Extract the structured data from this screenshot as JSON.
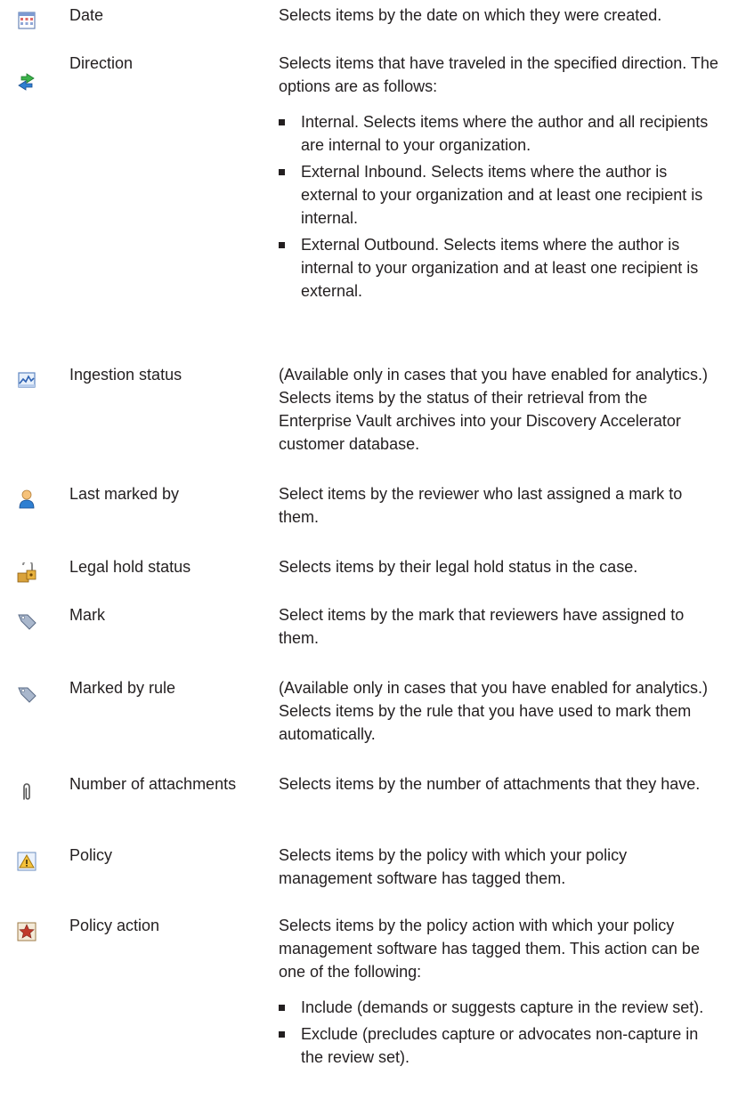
{
  "entries": [
    {
      "icon": "calendar-icon",
      "term": "Date",
      "description": "Selects items by the date on which they were created."
    },
    {
      "icon": "direction-arrows-icon",
      "term": "Direction",
      "description": "Selects items that have traveled in the specified direction. The options are as follows:",
      "bullets": [
        "Internal. Selects items where the author and all recipients are internal to your organization.",
        "External Inbound. Selects items where the author is external to your organization and at least one recipient is internal.",
        "External Outbound. Selects items where the author is internal to your organization and at least one recipient is external."
      ]
    },
    {
      "icon": "ingestion-chart-icon",
      "term": "Ingestion status",
      "description": "(Available only in cases that you have enabled for analytics.) Selects items by the status of their retrieval from the Enterprise Vault archives into your Discovery Accelerator customer database."
    },
    {
      "icon": "user-icon",
      "term": "Last marked by",
      "description": "Select items by the reviewer who last assigned a mark to them."
    },
    {
      "icon": "legal-hold-lock-icon",
      "term": "Legal hold status",
      "description": "Selects items by their legal hold status in the case."
    },
    {
      "icon": "mark-tag-icon",
      "term": "Mark",
      "description": "Select items by the mark that reviewers have assigned to them."
    },
    {
      "icon": "mark-rule-tag-icon",
      "term": "Marked by rule",
      "description": "(Available only in cases that you have enabled for analytics.) Selects items by the rule that you have used to mark them automatically."
    },
    {
      "icon": "paperclip-icon",
      "term": "Number of attachments",
      "description": "Selects items by the number of attachments that they have."
    },
    {
      "icon": "policy-warning-icon",
      "term": "Policy",
      "description": "Selects items by the policy with which your policy management software has tagged them."
    },
    {
      "icon": "policy-action-star-icon",
      "term": "Policy action",
      "description": "Selects items by the policy action with which your policy management software has tagged them. This action can be one of the following:",
      "bullets": [
        "Include (demands or suggests capture in the review set).",
        "Exclude (precludes capture or advocates non-capture in the review set)."
      ]
    }
  ]
}
